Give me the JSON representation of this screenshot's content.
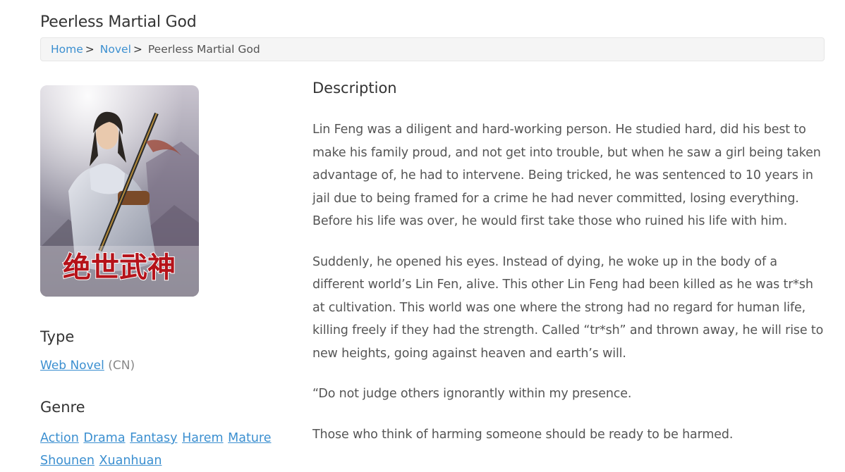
{
  "page": {
    "title": "Peerless Martial God"
  },
  "breadcrumb": {
    "home": "Home",
    "separator": ">",
    "novel": "Novel",
    "current": "Peerless Martial God"
  },
  "cover": {
    "chinese_title": "绝世武神"
  },
  "type": {
    "heading": "Type",
    "value": "Web Novel",
    "origin": "(CN)"
  },
  "genre": {
    "heading": "Genre",
    "items": [
      "Action",
      "Drama",
      "Fantasy",
      "Harem",
      "Mature",
      "Shounen",
      "Xuanhuan"
    ]
  },
  "description": {
    "heading": "Description",
    "paragraphs": [
      "Lin Feng was a diligent and hard-working person. He studied hard, did his best to make his family proud, and not get into trouble, but when he saw a girl being taken advantage of, he had to intervene. Being tricked, he was sentenced to 10 years in jail due to being framed for a crime he had never committed, losing everything. Before his life was over, he would first take those who ruined his life with him.",
      "Suddenly, he opened his eyes. Instead of dying, he woke up in the body of a different world’s Lin Fen, alive. This other Lin Feng had been killed as he was tr*sh at cultivation. This world was one where the strong had no regard for human life, killing freely if they had the strength. Called “tr*sh” and thrown away, he will rise to new heights, going against heaven and earth’s will.",
      "“Do not judge others ignorantly within my presence.",
      "Those who think of harming someone should be ready to be harmed."
    ]
  },
  "colors": {
    "link": "#3b8fd0",
    "text": "#555555",
    "heading": "#333333",
    "breadcrumb_bg": "#f5f5f5"
  }
}
